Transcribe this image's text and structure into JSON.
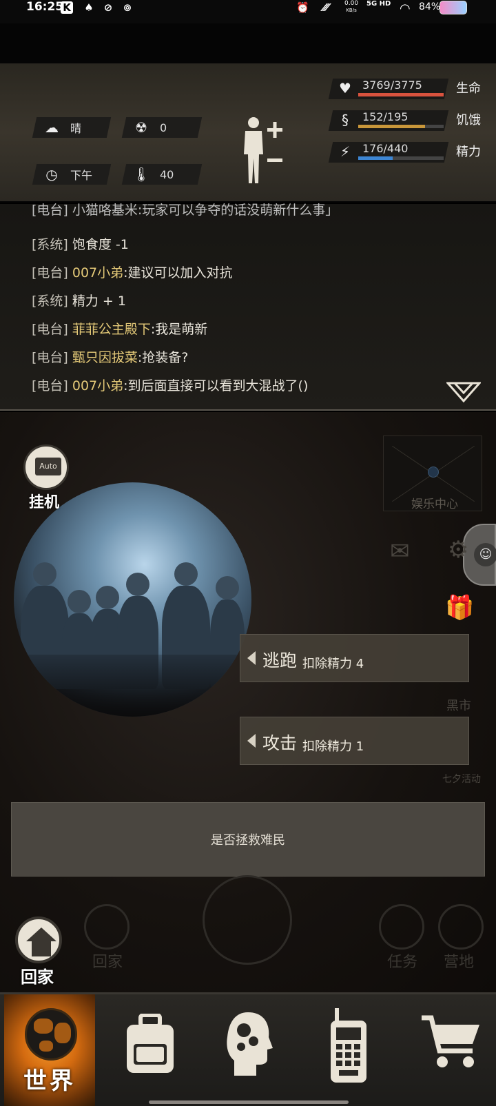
{
  "status_bar": {
    "time": "16:25",
    "net_speed_top": "0.00",
    "net_speed_unit": "KB/s",
    "network": "5G HD",
    "battery": "84%"
  },
  "stats": {
    "weather": "晴",
    "radiation": "0",
    "time_of_day": "下午",
    "temperature": "40",
    "bars": [
      {
        "icon": "heart-icon",
        "value": "3769/3775",
        "label": "生命",
        "current": 3769,
        "max": 3775,
        "color": "#d9533e"
      },
      {
        "icon": "stomach-icon",
        "value": "152/195",
        "label": "饥饿",
        "current": 152,
        "max": 195,
        "color": "#c9973a"
      },
      {
        "icon": "energy-icon",
        "value": "176/440",
        "label": "精力",
        "current": 176,
        "max": 440,
        "color": "#3d86d4"
      }
    ]
  },
  "log": {
    "partial_line": "[电台] 小猫咯基米:玩家可以争夺的话没萌新什么事」",
    "lines": [
      {
        "tag": "[系统]",
        "user": "",
        "msg": "饱食度 -1"
      },
      {
        "tag": "[电台]",
        "user": "007小弟",
        "msg": ":建议可以加入对抗"
      },
      {
        "tag": "[系统]",
        "user": "",
        "msg": "精力 + 1"
      },
      {
        "tag": "[电台]",
        "user": "菲菲公主殿下",
        "msg": ":我是萌新"
      },
      {
        "tag": "[电台]",
        "user": "甄只因拔菜",
        "msg": ":抢装备?"
      },
      {
        "tag": "[电台]",
        "user": "007小弟",
        "msg": ":到后面直接可以看到大混战了()"
      }
    ]
  },
  "scene": {
    "auto_label": "挂机",
    "auto_screen": "Auto",
    "entertainment": "娱乐中心",
    "black_market": "黑市",
    "qixi": "七夕活动",
    "bg_home": "回家",
    "bg_task": "任务",
    "bg_camp": "营地"
  },
  "actions": [
    {
      "title": "逃跑",
      "cost": "扣除精力 4"
    },
    {
      "title": "攻击",
      "cost": "扣除精力 1"
    }
  ],
  "prompt": "是否拯救难民",
  "home_button": "回家",
  "bottom_nav": {
    "world": "世界",
    "items": [
      "backpack-icon",
      "brain-skills-icon",
      "walkie-talkie-icon",
      "shopping-cart-icon"
    ]
  },
  "colors": {
    "accent_orange": "#e07a1c",
    "username": "#e4c978"
  }
}
